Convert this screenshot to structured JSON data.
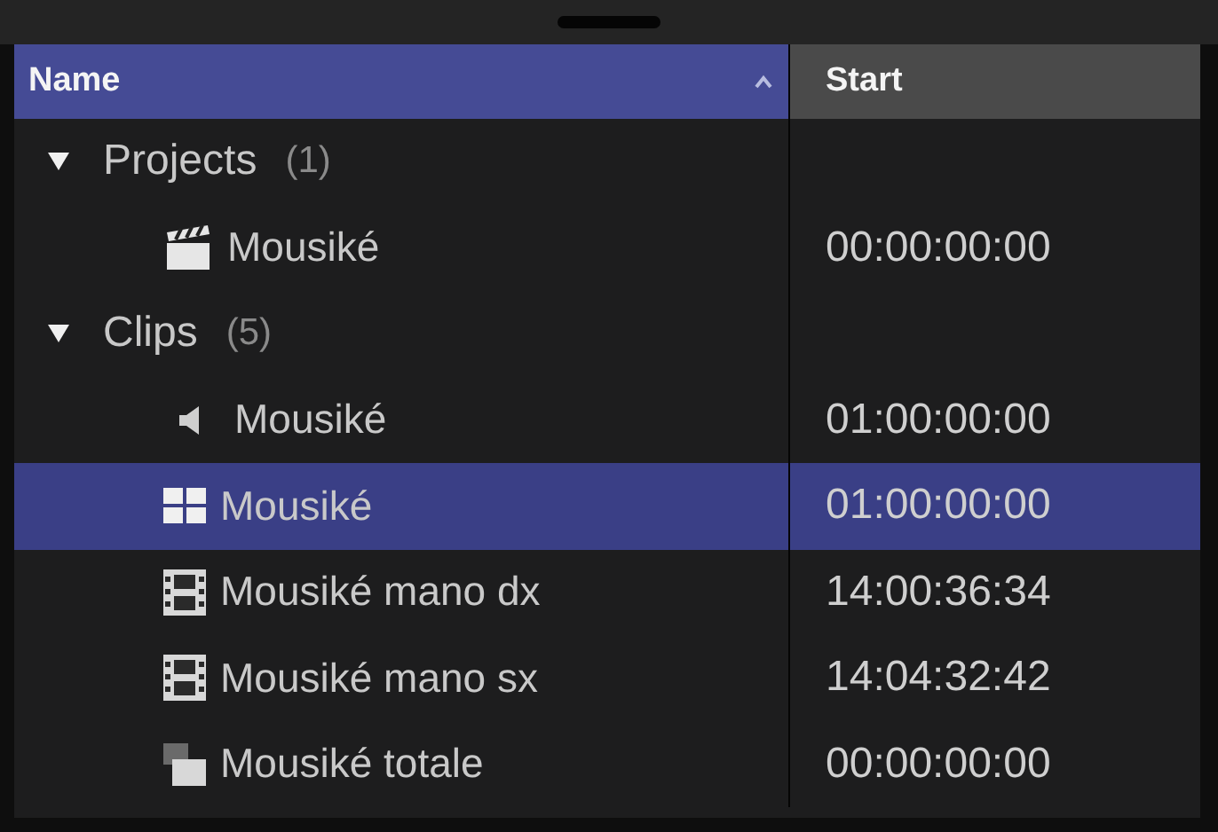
{
  "columns": [
    {
      "label": "Name",
      "selected": true,
      "sorted": true
    },
    {
      "label": "Start",
      "selected": false
    }
  ],
  "groups": [
    {
      "label": "Projects",
      "count": "(1)",
      "expanded": true,
      "children": [
        {
          "kind": "project",
          "name": "Mousiké",
          "start": "00:00:00:00",
          "selected": false
        }
      ]
    },
    {
      "label": "Clips",
      "count": "(5)",
      "expanded": true,
      "children": [
        {
          "kind": "audio",
          "name": "Mousiké",
          "start": "01:00:00:00",
          "selected": false
        },
        {
          "kind": "multicam",
          "name": "Mousiké",
          "start": "01:00:00:00",
          "selected": true
        },
        {
          "kind": "video",
          "name": "Mousiké mano dx",
          "start": "14:00:36:34",
          "selected": false
        },
        {
          "kind": "video",
          "name": "Mousiké mano sx",
          "start": "14:04:32:42",
          "selected": false
        },
        {
          "kind": "compound",
          "name": "Mousiké totale",
          "start": "00:00:00:00",
          "selected": false
        }
      ]
    }
  ]
}
